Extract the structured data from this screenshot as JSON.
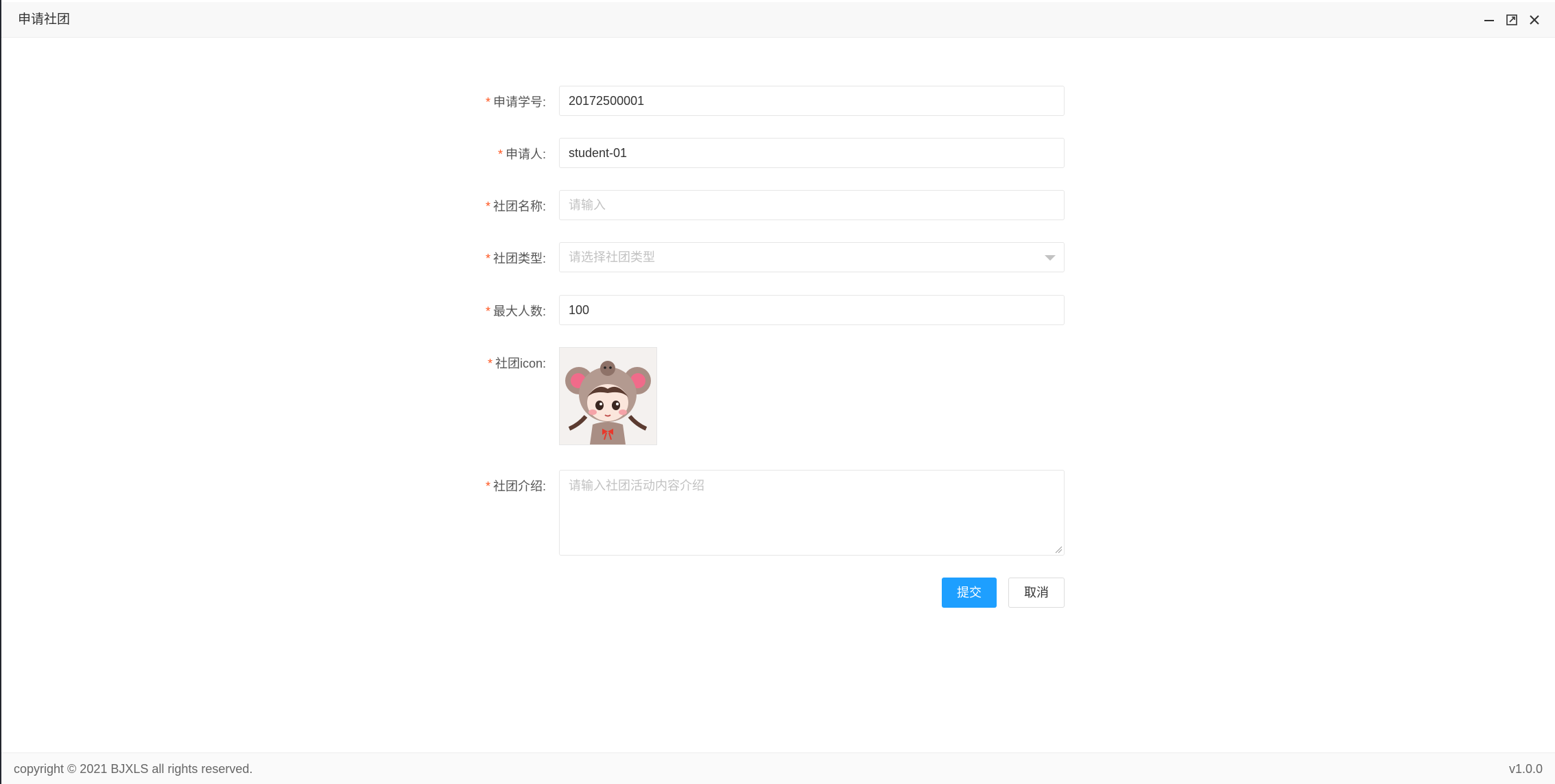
{
  "dialog": {
    "title": "申请社团"
  },
  "form": {
    "student_id": {
      "label": "申请学号:",
      "value": "20172500001"
    },
    "applicant": {
      "label": "申请人:",
      "value": "student-01"
    },
    "club_name": {
      "label": "社团名称:",
      "placeholder": "请输入"
    },
    "club_type": {
      "label": "社团类型:",
      "placeholder": "请选择社团类型"
    },
    "max_members": {
      "label": "最大人数:",
      "value": "100"
    },
    "club_icon": {
      "label": "社团icon:"
    },
    "club_intro": {
      "label": "社团介绍:",
      "placeholder": "请输入社团活动内容介绍"
    },
    "required_mark": "*"
  },
  "buttons": {
    "submit": "提交",
    "cancel": "取消"
  },
  "footer": {
    "copyright": "copyright © 2021 BJXLS all rights reserved.",
    "version": "v1.0.0"
  },
  "colors": {
    "primary": "#1e9fff",
    "required": "#ff5722",
    "placeholder": "#c2c2c2"
  }
}
